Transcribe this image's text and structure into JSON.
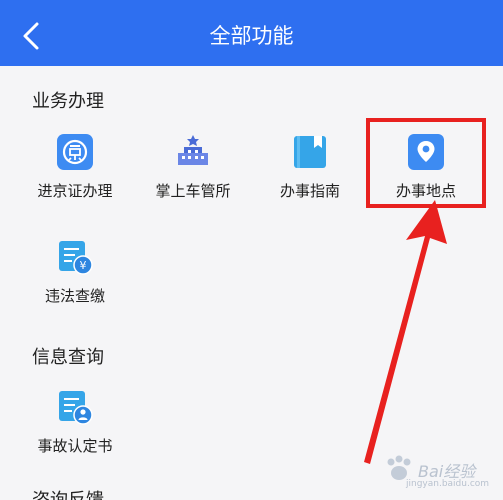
{
  "header": {
    "title": "全部功能"
  },
  "sections": {
    "business": {
      "title": "业务办理",
      "items": [
        {
          "label": "进京证办理",
          "icon": "jing-badge-icon"
        },
        {
          "label": "掌上车管所",
          "icon": "building-icon"
        },
        {
          "label": "办事指南",
          "icon": "guide-book-icon"
        },
        {
          "label": "办事地点",
          "icon": "location-pin-icon"
        },
        {
          "label": "违法查缴",
          "icon": "fine-payment-icon"
        }
      ]
    },
    "info": {
      "title": "信息查询",
      "items": [
        {
          "label": "事故认定书",
          "icon": "accident-report-icon"
        }
      ]
    },
    "consult": {
      "title": "咨询反馈"
    }
  },
  "watermark": {
    "text": "Bai经验",
    "sub": "jingyan.baidu.com"
  },
  "colors": {
    "header": "#2e6ff0",
    "icon_blue": "#3d8bf2",
    "highlight": "#e8211f"
  }
}
